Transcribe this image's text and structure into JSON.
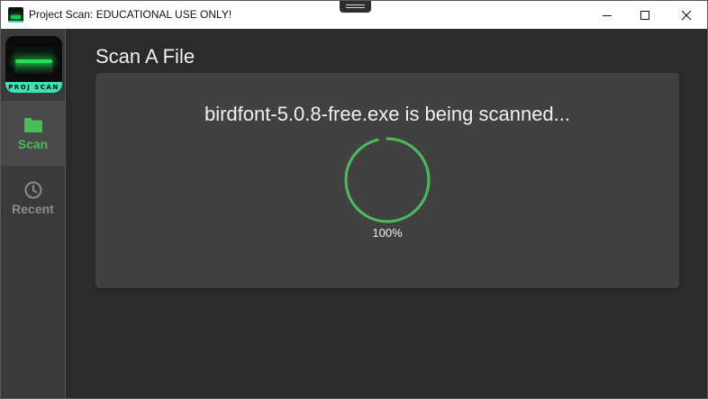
{
  "window": {
    "title": "Project Scan: EDUCATIONAL USE ONLY!",
    "app_icon": "app-logo-icon",
    "controls": {
      "minimize_icon": "minimize-icon",
      "maximize_icon": "maximize-icon",
      "close_icon": "close-icon"
    }
  },
  "sidebar": {
    "logo_text": "PROJ SCAN",
    "items": [
      {
        "label": "Scan",
        "icon": "folder-icon",
        "active": true
      },
      {
        "label": "Recent",
        "icon": "clock-icon",
        "active": false
      }
    ]
  },
  "main": {
    "page_title": "Scan A File",
    "scan_message": "birdfont-5.0.8-free.exe is being scanned...",
    "progress": {
      "value": 1.0,
      "label": "100%"
    }
  },
  "colors": {
    "accent": "#4cbc5a",
    "background": "#2b2b2b",
    "sidebar": "#3a3a3a",
    "sidebar_active": "#4a4a4a",
    "card": "#414141",
    "text": "#f0f0f0",
    "muted": "#8c8c8c",
    "logo_band": "#3ee0b4"
  }
}
